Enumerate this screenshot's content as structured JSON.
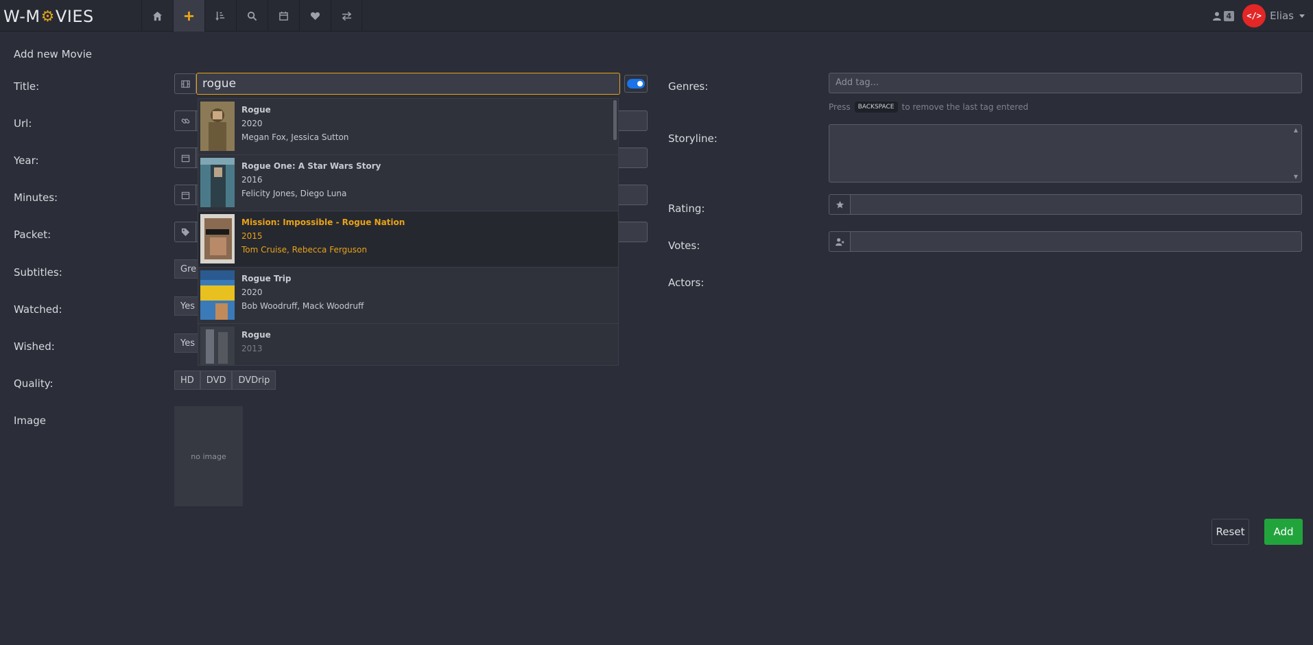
{
  "brand": {
    "text_before": "W-M",
    "gear": "⚙",
    "text_after": "VIES"
  },
  "nav": {
    "items": [
      {
        "name": "home-icon"
      },
      {
        "name": "plus-icon"
      },
      {
        "name": "sort-icon"
      },
      {
        "name": "search-icon"
      },
      {
        "name": "calendar-icon"
      },
      {
        "name": "heart-icon"
      },
      {
        "name": "exchange-icon"
      }
    ],
    "users_count": "4",
    "avatar_text": "</>",
    "user_name": "Elias"
  },
  "form": {
    "heading": "Add new Movie",
    "labels": {
      "title": "Title:",
      "url": "Url:",
      "year": "Year:",
      "minutes": "Minutes:",
      "packet": "Packet:",
      "subtitles": "Subtitles:",
      "watched": "Watched:",
      "wished": "Wished:",
      "quality": "Quality:",
      "image": "Image"
    },
    "title_value": "rogue",
    "subtitles_option": "Gre",
    "watched_option": "Yes",
    "wished_option": "Yes",
    "quality_options": [
      "HD",
      "DVD",
      "DVDrip"
    ],
    "no_image_text": "no image"
  },
  "suggestions": [
    {
      "title": "Rogue",
      "year": "2020",
      "actors": "Megan Fox, Jessica Sutton"
    },
    {
      "title": "Rogue One: A Star Wars Story",
      "year": "2016",
      "actors": "Felicity Jones, Diego Luna"
    },
    {
      "title": "Mission: Impossible - Rogue Nation",
      "year": "2015",
      "actors": "Tom Cruise, Rebecca Ferguson"
    },
    {
      "title": "Rogue Trip",
      "year": "2020",
      "actors": "Bob Woodruff, Mack Woodruff"
    },
    {
      "title": "Rogue",
      "year": "2013",
      "actors": ""
    }
  ],
  "right": {
    "labels": {
      "genres": "Genres:",
      "storyline": "Storyline:",
      "rating": "Rating:",
      "votes": "Votes:",
      "actors": "Actors:"
    },
    "tag_placeholder": "Add tag...",
    "hint_before": "Press",
    "hint_key": "BACKSPACE",
    "hint_after": "to remove the last tag entered"
  },
  "buttons": {
    "reset": "Reset",
    "add": "Add"
  },
  "colors": {
    "accent": "#e8a317",
    "add_green": "#22a43d",
    "toggle_blue": "#1a73e8",
    "avatar_red": "#e32626"
  }
}
